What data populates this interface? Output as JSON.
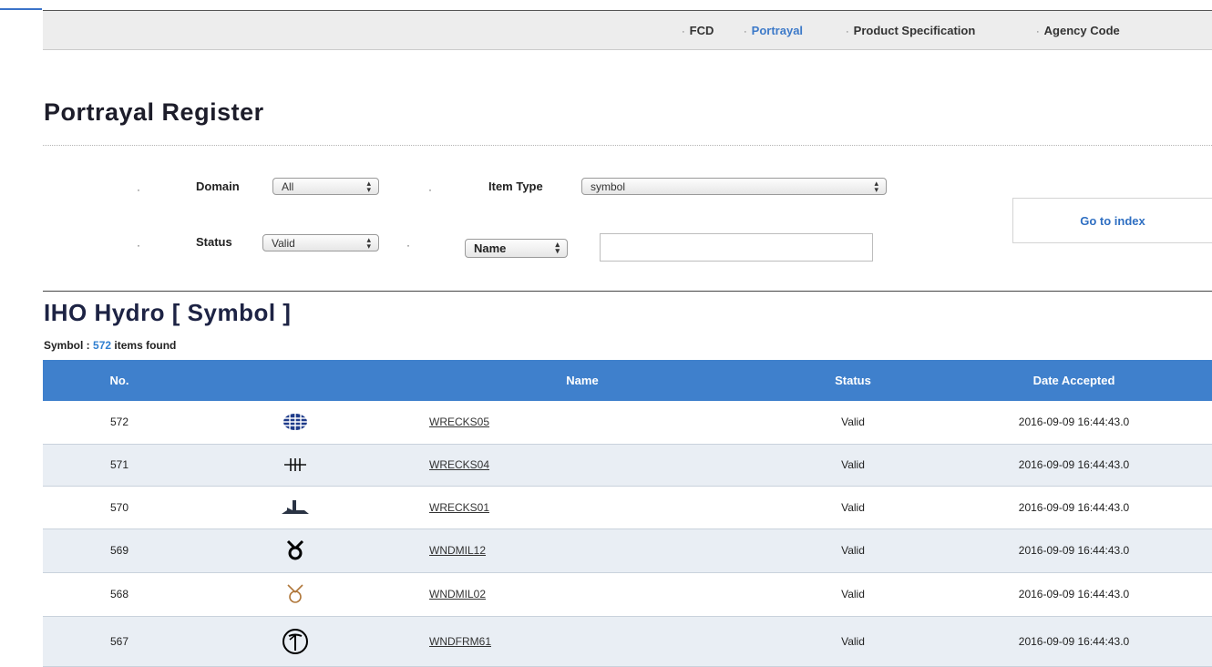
{
  "nav": {
    "items": [
      {
        "label": "FCD",
        "active": false
      },
      {
        "label": "Portrayal",
        "active": true
      },
      {
        "label": "Product Specification",
        "active": false
      },
      {
        "label": "Agency Code",
        "active": false
      }
    ],
    "bullet": "·"
  },
  "page_title": "Portrayal Register",
  "filters": {
    "bullet": "·",
    "domain": {
      "label": "Domain",
      "value": "All"
    },
    "item_type": {
      "label": "Item Type",
      "value": "symbol"
    },
    "status": {
      "label": "Status",
      "value": "Valid"
    },
    "search_field": {
      "value": "Name",
      "text": ""
    },
    "go_to_index": "Go to index"
  },
  "section": {
    "title": "IHO Hydro [ Symbol ]",
    "count_prefix": "Symbol :",
    "count": "572",
    "count_suffix": "items found"
  },
  "table": {
    "headers": [
      "No.",
      "",
      "Name",
      "Status",
      "Date Accepted"
    ],
    "rows": [
      {
        "no": "572",
        "icon": "wreck-grid-icon",
        "name": "WRECKS05",
        "status": "Valid",
        "date": "2016-09-09 16:44:43.0"
      },
      {
        "no": "571",
        "icon": "wreck-hash-icon",
        "name": "WRECKS04",
        "status": "Valid",
        "date": "2016-09-09 16:44:43.0"
      },
      {
        "no": "570",
        "icon": "wreck-hull-icon",
        "name": "WRECKS01",
        "status": "Valid",
        "date": "2016-09-09 16:44:43.0"
      },
      {
        "no": "569",
        "icon": "windmill-icon",
        "name": "WNDMIL12",
        "status": "Valid",
        "date": "2016-09-09 16:44:43.0"
      },
      {
        "no": "568",
        "icon": "windmill-outline-icon",
        "name": "WNDMIL02",
        "status": "Valid",
        "date": "2016-09-09 16:44:43.0"
      },
      {
        "no": "567",
        "icon": "wind-turbine-circle-icon",
        "name": "WNDFRM61",
        "status": "Valid",
        "date": "2016-09-09 16:44:43.0"
      }
    ]
  },
  "colors": {
    "accent": "#3f80cc",
    "link_active": "#3d7ac9",
    "count_number": "#2f7fd0",
    "row_alt": "#e9eef4",
    "windmill_outline": "#b0773a"
  }
}
